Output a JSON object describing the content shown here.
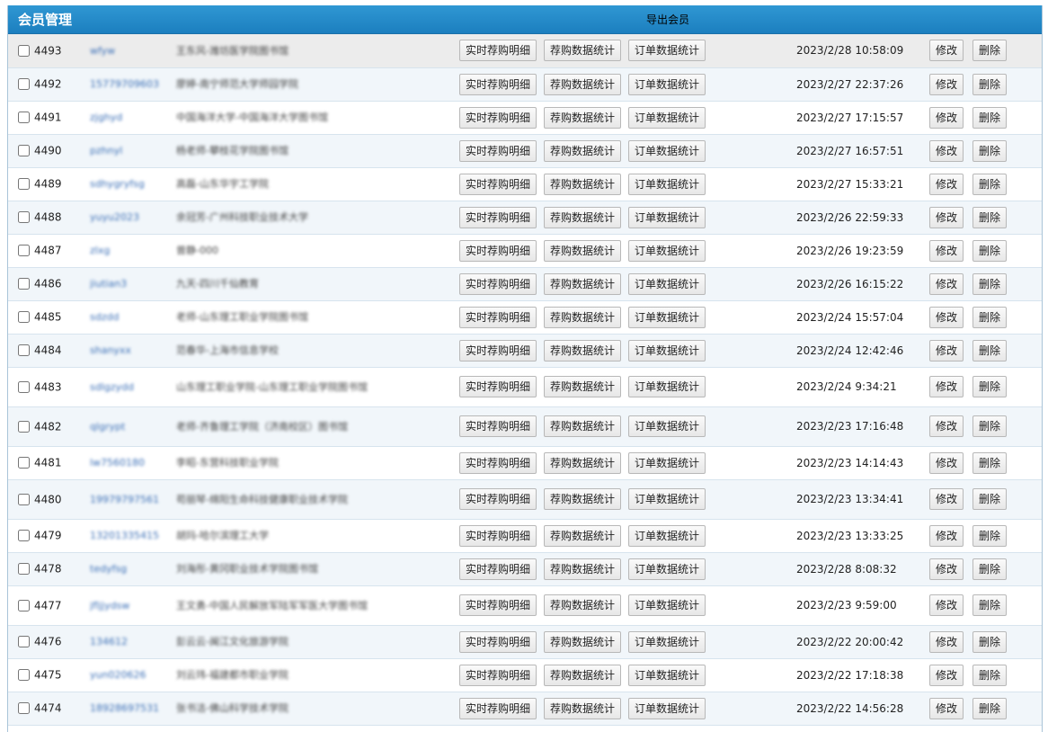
{
  "header": {
    "title": "会员管理",
    "export_label": "导出会员"
  },
  "actions": {
    "realtime_detail": "实时荐购明细",
    "recommend_stats": "荐购数据统计",
    "order_stats": "订单数据统计",
    "edit": "修改",
    "delete": "删除"
  },
  "rows": [
    {
      "id": "4493",
      "user": "wfyw",
      "org": "王东风-潍坊医学院图书馆",
      "time": "2023/2/28 10:58:09"
    },
    {
      "id": "4492",
      "user": "15779709603",
      "org": "廖婷-南宁师范大学师园学院",
      "time": "2023/2/27 22:37:26"
    },
    {
      "id": "4491",
      "user": "zjghyd",
      "org": "中国海洋大学-中国海洋大学图书馆",
      "time": "2023/2/27 17:15:57"
    },
    {
      "id": "4490",
      "user": "pzhnyl",
      "org": "杨老师-攀枝花学院图书馆",
      "time": "2023/2/27 16:57:51"
    },
    {
      "id": "4489",
      "user": "sdhygryfsg",
      "org": "高磊-山东华宇工学院",
      "time": "2023/2/27 15:33:21"
    },
    {
      "id": "4488",
      "user": "yuyu2023",
      "org": "余冠芳-广州科技职业技术大学",
      "time": "2023/2/26 22:59:33"
    },
    {
      "id": "4487",
      "user": "zlxg",
      "org": "曾静-000",
      "time": "2023/2/26 19:23:59"
    },
    {
      "id": "4486",
      "user": "jiutian3",
      "org": "九天-四川千仙教育",
      "time": "2023/2/26 16:15:22"
    },
    {
      "id": "4485",
      "user": "sdzdd",
      "org": "老师-山东理工职业学院图书馆",
      "time": "2023/2/24 15:57:04"
    },
    {
      "id": "4484",
      "user": "shanyxx",
      "org": "范春华-上海市信息学校",
      "time": "2023/2/24 12:42:46"
    },
    {
      "id": "4483",
      "user": "sdlgzydd",
      "org": "山东理工职业学院-山东理工职业学院图书馆",
      "time": "2023/2/24 9:34:21"
    },
    {
      "id": "4482",
      "user": "qlgrypt",
      "org": "老师-齐鲁理工学院（济南校区）图书馆",
      "time": "2023/2/23 17:16:48"
    },
    {
      "id": "4481",
      "user": "lw7560180",
      "org": "李昭-东营科技职业学院",
      "time": "2023/2/23 14:14:43"
    },
    {
      "id": "4480",
      "user": "19979797561",
      "org": "苟丽琴-绵阳生命科技健康职业技术学院",
      "time": "2023/2/23 13:34:41"
    },
    {
      "id": "4479",
      "user": "13201335415",
      "org": "胡玛-哈尔滨理工大学",
      "time": "2023/2/23 13:33:25"
    },
    {
      "id": "4478",
      "user": "tedyfsg",
      "org": "刘海彤-黄冈职业技术学院图书馆",
      "time": "2023/2/28 8:08:32"
    },
    {
      "id": "4477",
      "user": "jfljjydsw",
      "org": "王文勇-中国人民解放军陆军军医大学图书馆",
      "time": "2023/2/23 9:59:00"
    },
    {
      "id": "4476",
      "user": "134612",
      "org": "彭云云-闽江文化旅游学院",
      "time": "2023/2/22 20:00:42"
    },
    {
      "id": "4475",
      "user": "yun020626",
      "org": "刘云玮-福建都市职业学院",
      "time": "2023/2/22 17:18:38"
    },
    {
      "id": "4474",
      "user": "18928697531",
      "org": "张书洁-佛山科学技术学院",
      "time": "2023/2/22 14:56:28"
    }
  ]
}
